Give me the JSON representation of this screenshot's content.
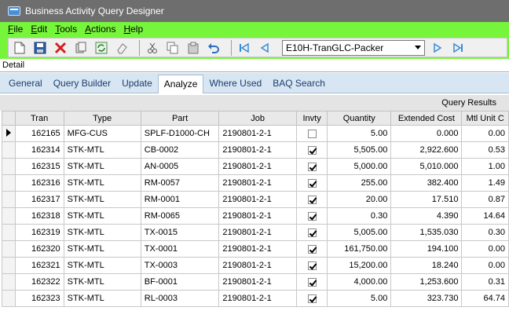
{
  "window": {
    "title": "Business Activity Query Designer"
  },
  "menu": [
    {
      "label": "File",
      "key": "F",
      "rest": "ile"
    },
    {
      "label": "Edit",
      "key": "E",
      "rest": "dit"
    },
    {
      "label": "Tools",
      "key": "T",
      "rest": "ools"
    },
    {
      "label": "Actions",
      "key": "A",
      "rest": "ctions"
    },
    {
      "label": "Help",
      "key": "H",
      "rest": "elp"
    }
  ],
  "toolbar": {
    "query_id": "E10H-TranGLC-Packer",
    "icons": [
      "new-icon",
      "save-icon",
      "delete-icon",
      "attach-icon",
      "refresh-icon",
      "clear-icon",
      "cut-icon",
      "copy-icon",
      "paste-icon",
      "undo-icon",
      "first-icon",
      "prev-icon",
      "next-icon",
      "last-icon"
    ],
    "colors": {
      "green_band": "#77f53b",
      "delete_red": "#d42020",
      "nav_blue": "#3a8ad6"
    }
  },
  "detail": {
    "label": "Detail"
  },
  "tabs": [
    {
      "label": "General",
      "active": false
    },
    {
      "label": "Query Builder",
      "active": false
    },
    {
      "label": "Update",
      "active": false
    },
    {
      "label": "Analyze",
      "active": true
    },
    {
      "label": "Where Used",
      "active": false
    },
    {
      "label": "BAQ Search",
      "active": false
    }
  ],
  "results": {
    "title": "Query Results",
    "columns": [
      "Tran",
      "Type",
      "Part",
      "Job",
      "Invty",
      "Quantity",
      "Extended Cost",
      "Mtl Unit C"
    ],
    "rows": [
      {
        "tran": "162165",
        "type": "MFG-CUS",
        "part": "SPLF-D1000-CH",
        "job": "2190801-2-1",
        "invty": false,
        "qty": "5.00",
        "ext": "0.000",
        "mtl": "0.00",
        "current": true
      },
      {
        "tran": "162314",
        "type": "STK-MTL",
        "part": "CB-0002",
        "job": "2190801-2-1",
        "invty": true,
        "qty": "5,505.00",
        "ext": "2,922.600",
        "mtl": "0.53",
        "current": false
      },
      {
        "tran": "162315",
        "type": "STK-MTL",
        "part": "AN-0005",
        "job": "2190801-2-1",
        "invty": true,
        "qty": "5,000.00",
        "ext": "5,010.000",
        "mtl": "1.00",
        "current": false
      },
      {
        "tran": "162316",
        "type": "STK-MTL",
        "part": "RM-0057",
        "job": "2190801-2-1",
        "invty": true,
        "qty": "255.00",
        "ext": "382.400",
        "mtl": "1.49",
        "current": false
      },
      {
        "tran": "162317",
        "type": "STK-MTL",
        "part": "RM-0001",
        "job": "2190801-2-1",
        "invty": true,
        "qty": "20.00",
        "ext": "17.510",
        "mtl": "0.87",
        "current": false
      },
      {
        "tran": "162318",
        "type": "STK-MTL",
        "part": "RM-0065",
        "job": "2190801-2-1",
        "invty": true,
        "qty": "0.30",
        "ext": "4.390",
        "mtl": "14.64",
        "current": false
      },
      {
        "tran": "162319",
        "type": "STK-MTL",
        "part": "TX-0015",
        "job": "2190801-2-1",
        "invty": true,
        "qty": "5,005.00",
        "ext": "1,535.030",
        "mtl": "0.30",
        "current": false
      },
      {
        "tran": "162320",
        "type": "STK-MTL",
        "part": "TX-0001",
        "job": "2190801-2-1",
        "invty": true,
        "qty": "161,750.00",
        "ext": "194.100",
        "mtl": "0.00",
        "current": false
      },
      {
        "tran": "162321",
        "type": "STK-MTL",
        "part": "TX-0003",
        "job": "2190801-2-1",
        "invty": true,
        "qty": "15,200.00",
        "ext": "18.240",
        "mtl": "0.00",
        "current": false
      },
      {
        "tran": "162322",
        "type": "STK-MTL",
        "part": "BF-0001",
        "job": "2190801-2-1",
        "invty": true,
        "qty": "4,000.00",
        "ext": "1,253.600",
        "mtl": "0.31",
        "current": false
      },
      {
        "tran": "162323",
        "type": "STK-MTL",
        "part": "RL-0003",
        "job": "2190801-2-1",
        "invty": true,
        "qty": "5.00",
        "ext": "323.730",
        "mtl": "64.74",
        "current": false
      }
    ]
  }
}
